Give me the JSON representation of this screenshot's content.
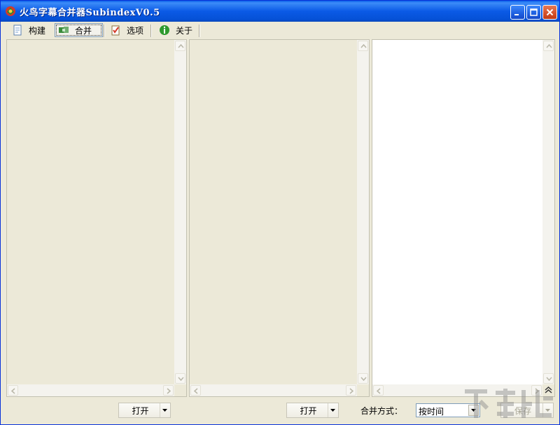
{
  "window": {
    "title": "火鸟字幕合并器SubindexV0.5",
    "controls": [
      "minimize-icon",
      "maximize-icon",
      "close-icon"
    ]
  },
  "toolbar": {
    "items": [
      {
        "label": "构建",
        "icon": "build-icon",
        "active": false
      },
      {
        "label": "合并",
        "icon": "merge-icon",
        "active": true
      },
      {
        "label": "选项",
        "icon": "options-icon",
        "active": false
      },
      {
        "label": "关于",
        "icon": "info-icon",
        "active": false
      }
    ]
  },
  "panels": {
    "left": {
      "background": "#ece9d8"
    },
    "middle": {
      "background": "#ece9d8"
    },
    "right": {
      "background": "#ffffff"
    }
  },
  "bottom": {
    "open_left_label": "打开",
    "open_middle_label": "打开",
    "merge_mode_label": "合并方式：",
    "merge_mode_value": "按时间",
    "save_label": "保存"
  },
  "colors": {
    "title_bar": "#0b5ae6",
    "face": "#ece9d8",
    "border": "#7f9db9"
  }
}
